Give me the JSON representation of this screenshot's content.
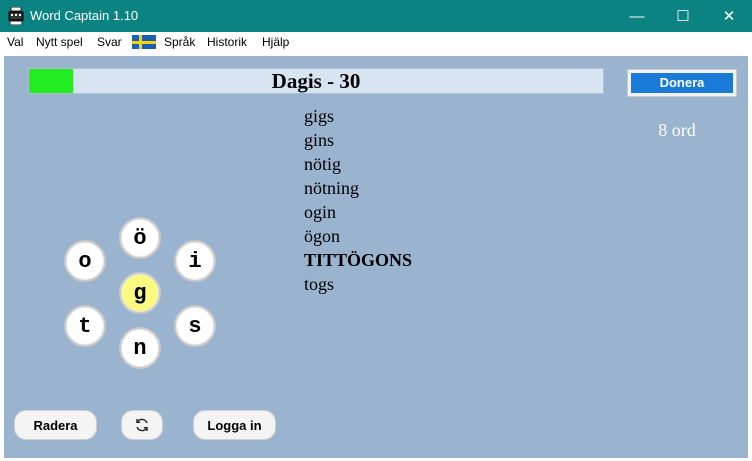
{
  "window": {
    "title": "Word Captain 1.10",
    "minimize": "—",
    "maximize": "☐",
    "close": "✕"
  },
  "menu": {
    "items": [
      "Val",
      "Nytt spel",
      "Svar"
    ],
    "flag_icon": "swedish-flag-icon",
    "language": "Språk",
    "history": "Historik",
    "help": "Hjälp"
  },
  "puzzle": {
    "title": "Dagis - 30",
    "progress": 0.077,
    "progress_color": "#22ee22"
  },
  "donate": {
    "label": "Donera"
  },
  "word_count": "8 ord",
  "found_words": [
    {
      "text": "gigs",
      "bold": false
    },
    {
      "text": "gins",
      "bold": false
    },
    {
      "text": "nötig",
      "bold": false
    },
    {
      "text": "nötning",
      "bold": false
    },
    {
      "text": "ogin",
      "bold": false
    },
    {
      "text": "ögon",
      "bold": false
    },
    {
      "text": "TITTÖGONS",
      "bold": true
    },
    {
      "text": "togs",
      "bold": false
    }
  ],
  "letters": {
    "top": "ö",
    "upper_left": "o",
    "upper_right": "i",
    "center": "g",
    "lower_left": "t",
    "lower_right": "s",
    "bottom": "n"
  },
  "buttons": {
    "delete": "Radera",
    "shuffle_icon": "refresh-icon",
    "login": "Logga in"
  },
  "colors": {
    "titlebar": "#0c8383",
    "background": "#9ab3cf",
    "center_letter": "#fafa80",
    "donate": "#1a7ad8"
  }
}
